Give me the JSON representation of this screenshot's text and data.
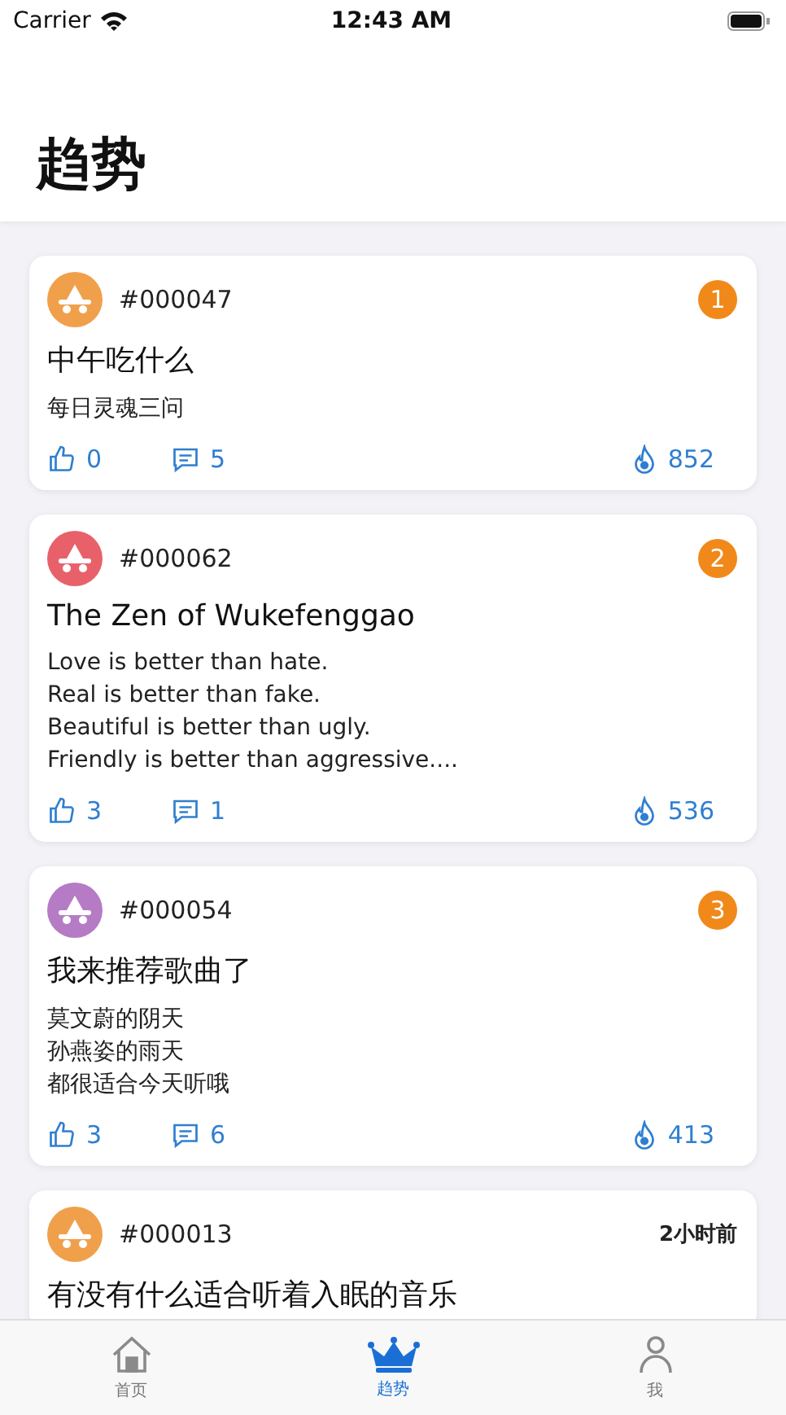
{
  "status_bar": {
    "carrier": "Carrier",
    "time": "12:43 AM"
  },
  "header": {
    "title": "趋势"
  },
  "posts": [
    {
      "id": "#000047",
      "color": "#f0a04b",
      "rank": "1",
      "title": "中午吃什么",
      "body": [
        "每日灵魂三问"
      ],
      "likes": "0",
      "comments": "5",
      "heat": "852"
    },
    {
      "id": "#000062",
      "color": "#e8616a",
      "rank": "2",
      "title": "The Zen of Wukefenggao",
      "body": [
        "Love is better than hate.",
        "Real is better than fake.",
        "Beautiful is better than ugly.",
        "Friendly is better than aggressive...."
      ],
      "likes": "3",
      "comments": "1",
      "heat": "536"
    },
    {
      "id": "#000054",
      "color": "#b57cc5",
      "rank": "3",
      "title": "我来推荐歌曲了",
      "body": [
        "莫文蔚的阴天",
        "孙燕姿的雨天",
        "都很适合今天听哦"
      ],
      "likes": "3",
      "comments": "6",
      "heat": "413"
    },
    {
      "id": "#000013",
      "color": "#f0a04b",
      "time": "2小时前",
      "title": "有没有什么适合听着入眠的音乐"
    }
  ],
  "tab_bar": [
    {
      "label": "首页",
      "kind": "home",
      "selected": false
    },
    {
      "label": "趋势",
      "kind": "crown",
      "selected": true
    },
    {
      "label": "我",
      "kind": "person",
      "selected": false
    }
  ]
}
